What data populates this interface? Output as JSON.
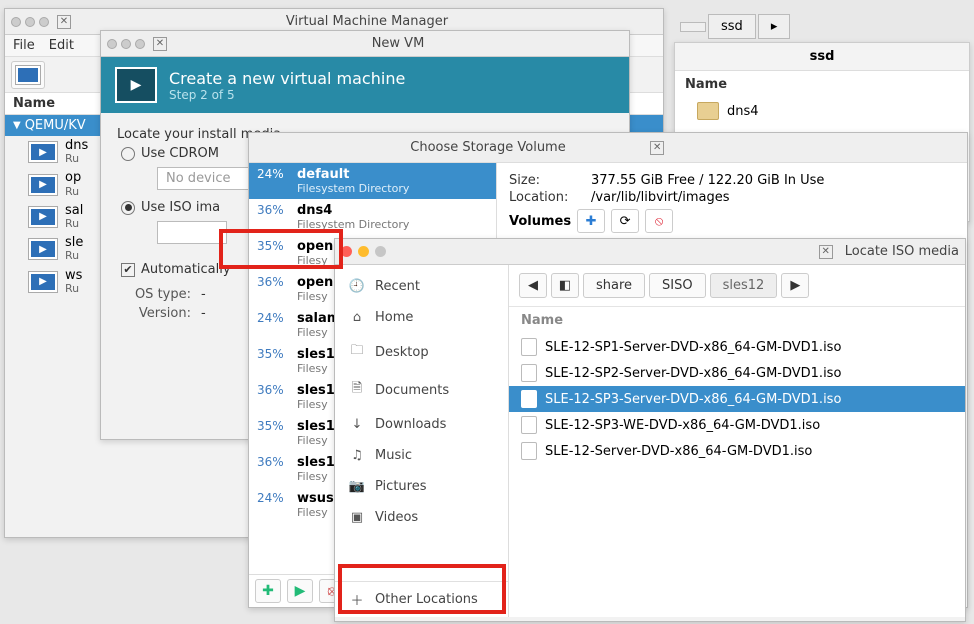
{
  "vmm": {
    "title": "Virtual Machine Manager",
    "menu": {
      "file": "File",
      "edit": "Edit"
    },
    "col_name": "Name",
    "host": "QEMU/KV",
    "vms": [
      {
        "name": "dns",
        "state": "Ru"
      },
      {
        "name": "op",
        "state": "Ru"
      },
      {
        "name": "sal",
        "state": "Ru"
      },
      {
        "name": "sle",
        "state": "Ru"
      },
      {
        "name": "ws",
        "state": "Ru"
      }
    ]
  },
  "newvm": {
    "title": "New VM",
    "heading": "Create a new virtual machine",
    "step": "Step 2 of 5",
    "locate_label": "Locate your install media",
    "use_cdrom": "Use CDROM",
    "no_device": "No device",
    "use_iso": "Use ISO ima",
    "auto_label": "Automatically",
    "os_type_label": "OS type:",
    "os_type_value": "-",
    "version_label": "Version:",
    "version_value": "-"
  },
  "storage": {
    "title": "Choose Storage Volume",
    "size_label": "Size:",
    "size_value": "377.55 GiB Free / 122.20 GiB In Use",
    "location_label": "Location:",
    "location_value": "/var/lib/libvirt/images",
    "volumes_label": "Volumes",
    "pools": [
      {
        "pct": "24%",
        "name": "default",
        "sub": "Filesystem Directory",
        "selected": true
      },
      {
        "pct": "36%",
        "name": "dns4",
        "sub": "Filesystem Directory"
      },
      {
        "pct": "35%",
        "name": "open",
        "sub": "Filesy"
      },
      {
        "pct": "36%",
        "name": "open",
        "sub": "Filesy"
      },
      {
        "pct": "24%",
        "name": "salam",
        "sub": "Filesy"
      },
      {
        "pct": "35%",
        "name": "sles1",
        "sub": "Filesy"
      },
      {
        "pct": "36%",
        "name": "sles1",
        "sub": "Filesy"
      },
      {
        "pct": "35%",
        "name": "sles1",
        "sub": "Filesy"
      },
      {
        "pct": "36%",
        "name": "sles1",
        "sub": "Filesy"
      },
      {
        "pct": "24%",
        "name": "wsus",
        "sub": "Filesy"
      }
    ]
  },
  "locate": {
    "title": "Locate ISO media",
    "side": {
      "recent": "Recent",
      "home": "Home",
      "desktop": "Desktop",
      "documents": "Documents",
      "downloads": "Downloads",
      "music": "Music",
      "pictures": "Pictures",
      "videos": "Videos",
      "other": "Other Locations"
    },
    "crumbs": {
      "share": "share",
      "siso": "SISO",
      "sles12": "sles12"
    },
    "col_name": "Name",
    "files": [
      {
        "name": "SLE-12-SP1-Server-DVD-x86_64-GM-DVD1.iso"
      },
      {
        "name": "SLE-12-SP2-Server-DVD-x86_64-GM-DVD1.iso"
      },
      {
        "name": "SLE-12-SP3-Server-DVD-x86_64-GM-DVD1.iso",
        "selected": true
      },
      {
        "name": "SLE-12-SP3-WE-DVD-x86_64-GM-DVD1.iso"
      },
      {
        "name": "SLE-12-Server-DVD-x86_64-GM-DVD1.iso"
      }
    ]
  },
  "ssd": {
    "tab": "ssd",
    "heading": "ssd",
    "name_col": "Name",
    "folder": "dns4"
  },
  "glyphs": {
    "plus": "✚",
    "refresh": "⟳",
    "delete": "⦸",
    "back": "◀",
    "fwd": "▶",
    "url": "◧",
    "clock": "🕘",
    "home": "⌂",
    "folder": "🗀",
    "doc": "🗎",
    "down": "↓",
    "music": "♫",
    "camera": "📷",
    "video": "▣",
    "plus2": "＋",
    "check": "✔"
  }
}
